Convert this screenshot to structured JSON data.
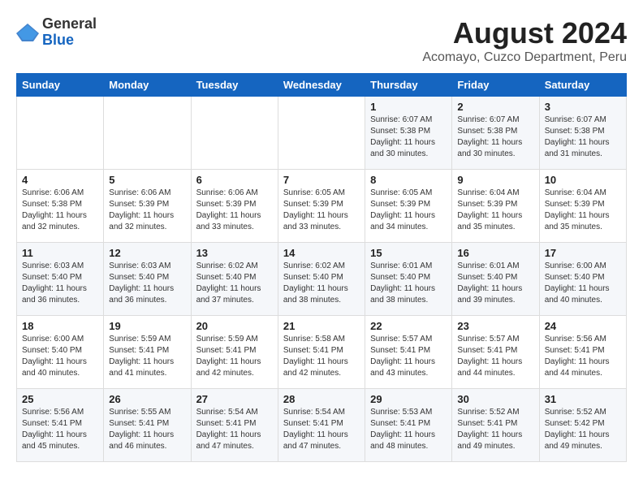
{
  "header": {
    "logo_line1": "General",
    "logo_line2": "Blue",
    "title": "August 2024",
    "subtitle": "Acomayo, Cuzco Department, Peru"
  },
  "weekdays": [
    "Sunday",
    "Monday",
    "Tuesday",
    "Wednesday",
    "Thursday",
    "Friday",
    "Saturday"
  ],
  "weeks": [
    [
      {
        "day": "",
        "info": ""
      },
      {
        "day": "",
        "info": ""
      },
      {
        "day": "",
        "info": ""
      },
      {
        "day": "",
        "info": ""
      },
      {
        "day": "1",
        "info": "Sunrise: 6:07 AM\nSunset: 5:38 PM\nDaylight: 11 hours\nand 30 minutes."
      },
      {
        "day": "2",
        "info": "Sunrise: 6:07 AM\nSunset: 5:38 PM\nDaylight: 11 hours\nand 30 minutes."
      },
      {
        "day": "3",
        "info": "Sunrise: 6:07 AM\nSunset: 5:38 PM\nDaylight: 11 hours\nand 31 minutes."
      }
    ],
    [
      {
        "day": "4",
        "info": "Sunrise: 6:06 AM\nSunset: 5:38 PM\nDaylight: 11 hours\nand 32 minutes."
      },
      {
        "day": "5",
        "info": "Sunrise: 6:06 AM\nSunset: 5:39 PM\nDaylight: 11 hours\nand 32 minutes."
      },
      {
        "day": "6",
        "info": "Sunrise: 6:06 AM\nSunset: 5:39 PM\nDaylight: 11 hours\nand 33 minutes."
      },
      {
        "day": "7",
        "info": "Sunrise: 6:05 AM\nSunset: 5:39 PM\nDaylight: 11 hours\nand 33 minutes."
      },
      {
        "day": "8",
        "info": "Sunrise: 6:05 AM\nSunset: 5:39 PM\nDaylight: 11 hours\nand 34 minutes."
      },
      {
        "day": "9",
        "info": "Sunrise: 6:04 AM\nSunset: 5:39 PM\nDaylight: 11 hours\nand 35 minutes."
      },
      {
        "day": "10",
        "info": "Sunrise: 6:04 AM\nSunset: 5:39 PM\nDaylight: 11 hours\nand 35 minutes."
      }
    ],
    [
      {
        "day": "11",
        "info": "Sunrise: 6:03 AM\nSunset: 5:40 PM\nDaylight: 11 hours\nand 36 minutes."
      },
      {
        "day": "12",
        "info": "Sunrise: 6:03 AM\nSunset: 5:40 PM\nDaylight: 11 hours\nand 36 minutes."
      },
      {
        "day": "13",
        "info": "Sunrise: 6:02 AM\nSunset: 5:40 PM\nDaylight: 11 hours\nand 37 minutes."
      },
      {
        "day": "14",
        "info": "Sunrise: 6:02 AM\nSunset: 5:40 PM\nDaylight: 11 hours\nand 38 minutes."
      },
      {
        "day": "15",
        "info": "Sunrise: 6:01 AM\nSunset: 5:40 PM\nDaylight: 11 hours\nand 38 minutes."
      },
      {
        "day": "16",
        "info": "Sunrise: 6:01 AM\nSunset: 5:40 PM\nDaylight: 11 hours\nand 39 minutes."
      },
      {
        "day": "17",
        "info": "Sunrise: 6:00 AM\nSunset: 5:40 PM\nDaylight: 11 hours\nand 40 minutes."
      }
    ],
    [
      {
        "day": "18",
        "info": "Sunrise: 6:00 AM\nSunset: 5:40 PM\nDaylight: 11 hours\nand 40 minutes."
      },
      {
        "day": "19",
        "info": "Sunrise: 5:59 AM\nSunset: 5:41 PM\nDaylight: 11 hours\nand 41 minutes."
      },
      {
        "day": "20",
        "info": "Sunrise: 5:59 AM\nSunset: 5:41 PM\nDaylight: 11 hours\nand 42 minutes."
      },
      {
        "day": "21",
        "info": "Sunrise: 5:58 AM\nSunset: 5:41 PM\nDaylight: 11 hours\nand 42 minutes."
      },
      {
        "day": "22",
        "info": "Sunrise: 5:57 AM\nSunset: 5:41 PM\nDaylight: 11 hours\nand 43 minutes."
      },
      {
        "day": "23",
        "info": "Sunrise: 5:57 AM\nSunset: 5:41 PM\nDaylight: 11 hours\nand 44 minutes."
      },
      {
        "day": "24",
        "info": "Sunrise: 5:56 AM\nSunset: 5:41 PM\nDaylight: 11 hours\nand 44 minutes."
      }
    ],
    [
      {
        "day": "25",
        "info": "Sunrise: 5:56 AM\nSunset: 5:41 PM\nDaylight: 11 hours\nand 45 minutes."
      },
      {
        "day": "26",
        "info": "Sunrise: 5:55 AM\nSunset: 5:41 PM\nDaylight: 11 hours\nand 46 minutes."
      },
      {
        "day": "27",
        "info": "Sunrise: 5:54 AM\nSunset: 5:41 PM\nDaylight: 11 hours\nand 47 minutes."
      },
      {
        "day": "28",
        "info": "Sunrise: 5:54 AM\nSunset: 5:41 PM\nDaylight: 11 hours\nand 47 minutes."
      },
      {
        "day": "29",
        "info": "Sunrise: 5:53 AM\nSunset: 5:41 PM\nDaylight: 11 hours\nand 48 minutes."
      },
      {
        "day": "30",
        "info": "Sunrise: 5:52 AM\nSunset: 5:41 PM\nDaylight: 11 hours\nand 49 minutes."
      },
      {
        "day": "31",
        "info": "Sunrise: 5:52 AM\nSunset: 5:42 PM\nDaylight: 11 hours\nand 49 minutes."
      }
    ]
  ]
}
